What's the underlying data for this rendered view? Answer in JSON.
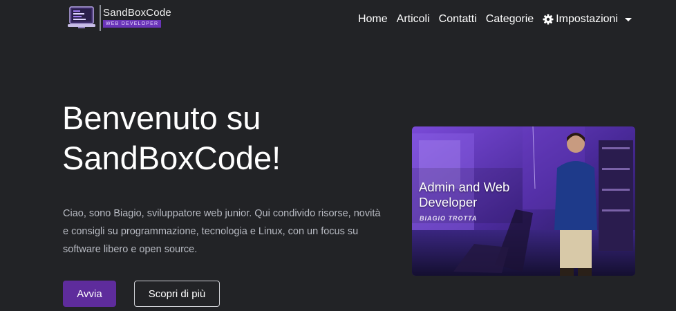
{
  "brand": {
    "name": "SandBoxCode",
    "tagline": "WEB DEVELOPER",
    "logo_icon": "laptop-code-icon"
  },
  "nav": {
    "items": [
      {
        "label": "Home"
      },
      {
        "label": "Articoli"
      },
      {
        "label": "Contatti"
      },
      {
        "label": "Categorie"
      }
    ],
    "settings": {
      "label": "Impostazioni",
      "icon": "gear-icon"
    }
  },
  "hero": {
    "title_line1": "Benvenuto su",
    "title_line2": "SandBoxCode!",
    "description": "Ciao, sono Biagio, sviluppatore web junior. Qui condivido risorse, novità e consigli su programmazione, tecnologia e Linux, con un focus su software libero e open source.",
    "primary_button": "Avvia",
    "secondary_button": "Scopri di più"
  },
  "hero_image": {
    "title_line1": "Admin and Web",
    "title_line2": "Developer",
    "subtitle": "BIAGIO TROTTA"
  },
  "colors": {
    "background": "#222326",
    "accent": "#5e2c9c",
    "text_muted": "#b9bcc4"
  }
}
